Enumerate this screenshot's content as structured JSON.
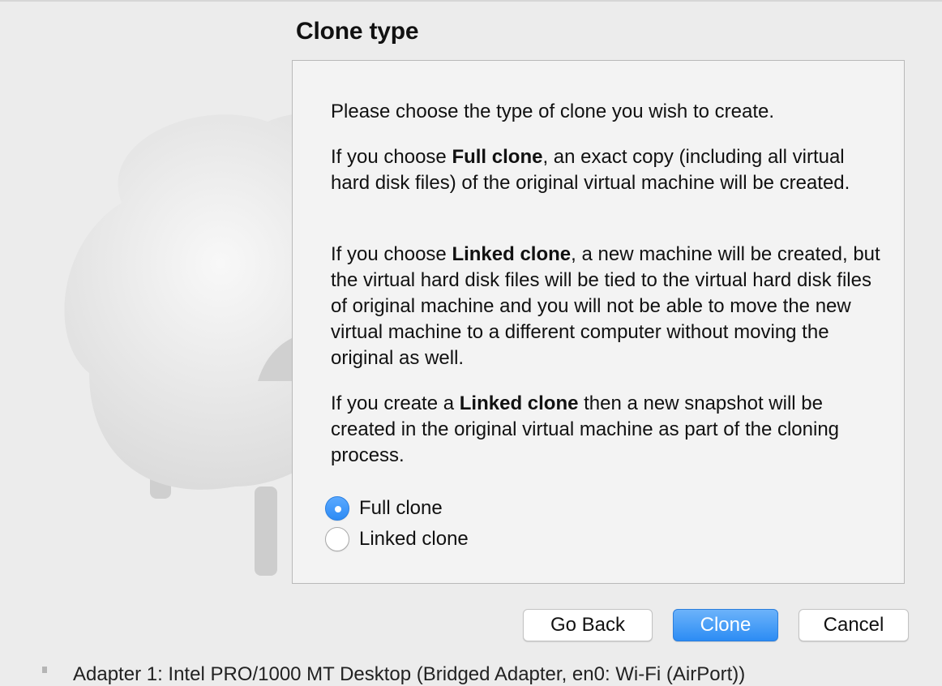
{
  "wizard": {
    "title": "Clone type",
    "intro": "Please choose the type of clone you wish to create.",
    "full_clone_para": {
      "before": "If you choose ",
      "bold": "Full clone",
      "after": ", an exact copy (including all virtual hard disk files) of the original virtual machine will be created."
    },
    "linked_clone_para": {
      "before": "If you choose ",
      "bold": "Linked clone",
      "after": ", a new machine will be created, but the virtual hard disk files will be tied to the virtual hard disk files of original machine and you will not be able to move the new virtual machine to a different computer without moving the original as well."
    },
    "snapshot_para": {
      "before": "If you create a ",
      "bold": "Linked clone",
      "after": " then a new snapshot will be created in the original virtual machine as part of the cloning process."
    },
    "options": [
      {
        "label": "Full clone",
        "selected": true
      },
      {
        "label": "Linked clone",
        "selected": false
      }
    ],
    "buttons": {
      "back": "Go Back",
      "clone": "Clone",
      "cancel": "Cancel"
    }
  },
  "background": {
    "status_text": "Adapter 1:   Intel PRO/1000 MT Desktop (Bridged Adapter, en0: Wi-Fi (AirPort))"
  },
  "colors": {
    "accent": "#2d8bf5",
    "panel": "#f3f3f3",
    "window": "#ececec"
  }
}
